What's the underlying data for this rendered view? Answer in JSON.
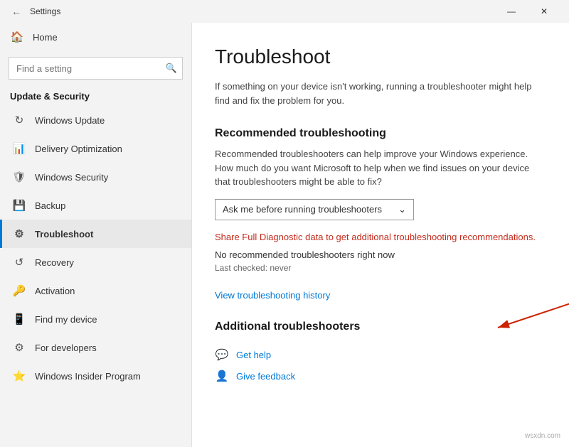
{
  "titlebar": {
    "title": "Settings",
    "minimize_label": "—",
    "close_label": "✕"
  },
  "sidebar": {
    "home_label": "Home",
    "search_placeholder": "Find a setting",
    "section_title": "Update & Security",
    "items": [
      {
        "id": "windows-update",
        "label": "Windows Update",
        "icon": "↻"
      },
      {
        "id": "delivery-optimization",
        "label": "Delivery Optimization",
        "icon": "📶"
      },
      {
        "id": "windows-security",
        "label": "Windows Security",
        "icon": "🛡"
      },
      {
        "id": "backup",
        "label": "Backup",
        "icon": "⬆"
      },
      {
        "id": "troubleshoot",
        "label": "Troubleshoot",
        "icon": "👤"
      },
      {
        "id": "recovery",
        "label": "Recovery",
        "icon": "↺"
      },
      {
        "id": "activation",
        "label": "Activation",
        "icon": "🔑"
      },
      {
        "id": "find-my-device",
        "label": "Find my device",
        "icon": "📍"
      },
      {
        "id": "for-developers",
        "label": "For developers",
        "icon": "💻"
      },
      {
        "id": "windows-insider",
        "label": "Windows Insider Program",
        "icon": "🪟"
      }
    ]
  },
  "main": {
    "page_title": "Troubleshoot",
    "page_description": "If something on your device isn't working, running a troubleshooter might help find and fix the problem for you.",
    "recommended_section": {
      "title": "Recommended troubleshooting",
      "description": "Recommended troubleshooters can help improve your Windows experience. How much do you want Microsoft to help when we find issues on your device that troubleshooters might be able to fix?",
      "dropdown_value": "Ask me before running troubleshooters",
      "dropdown_arrow": "⌄",
      "share_link": "Share Full Diagnostic data to get additional troubleshooting recommendations.",
      "no_troubleshooters": "No recommended troubleshooters right now",
      "last_checked": "Last checked: never"
    },
    "view_history_label": "View troubleshooting history",
    "additional_section": {
      "title": "Additional troubleshooters"
    },
    "help_links": [
      {
        "id": "get-help",
        "label": "Get help",
        "icon": "💬"
      },
      {
        "id": "give-feedback",
        "label": "Give feedback",
        "icon": "👤"
      }
    ]
  }
}
